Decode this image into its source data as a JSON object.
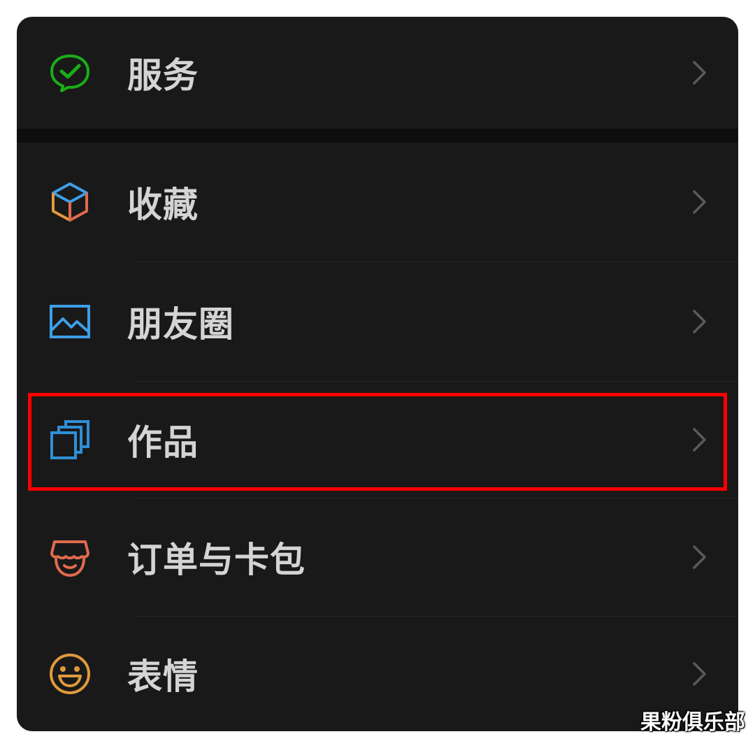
{
  "menu": {
    "items": [
      {
        "label": "服务",
        "icon": "wechat-pay-icon",
        "color": "#1aad19"
      },
      {
        "label": "收藏",
        "icon": "cube-favorites-icon",
        "color": "#3d9fe6"
      },
      {
        "label": "朋友圈",
        "icon": "photo-moments-icon",
        "color": "#3d9fe6"
      },
      {
        "label": "作品",
        "icon": "stacked-cards-icon",
        "color": "#2f8fd6"
      },
      {
        "label": "订单与卡包",
        "icon": "shop-awning-icon",
        "color": "#e06a4e"
      },
      {
        "label": "表情",
        "icon": "smiley-face-icon",
        "color": "#e09a3c"
      }
    ],
    "chevron_icon": "chevron-right-icon"
  },
  "highlight": {
    "color": "#ff0000",
    "target": "作品"
  },
  "watermark": "果粉俱乐部"
}
